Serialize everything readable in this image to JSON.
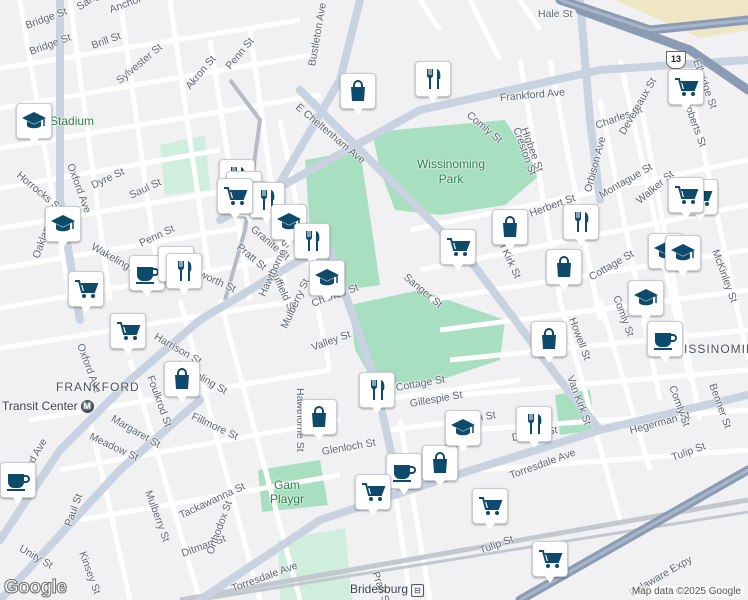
{
  "map": {
    "attribution": "Map data ©2025 Google",
    "logo": "Google",
    "route_shield": "13",
    "colors": {
      "background": "#f1f1f3",
      "street": "#ffffff",
      "major_road": "#c9d2e0",
      "highway": "#8a9bb3",
      "park": "#a8dfc0",
      "rail": "#b6bcc6",
      "poi_icon": "#0d4a6b"
    }
  },
  "places": [
    {
      "name": "FRANKFORD"
    },
    {
      "name": "ISSINOMIN"
    }
  ],
  "parks": [
    {
      "name": "Wissinoming Park"
    },
    {
      "name": "Gam Playgr"
    }
  ],
  "transit": {
    "frankford_center": "Transit Center",
    "frankford_center_icon": "M",
    "stadium": "ford Stadium",
    "bridesburg": "Bridesburg",
    "bridesburg_icon": "⊟"
  },
  "streets": [
    {
      "name": "Sanger St"
    },
    {
      "name": "Anchor St"
    },
    {
      "name": "Bridge St"
    },
    {
      "name": "Brill St"
    },
    {
      "name": "Sylvester St"
    },
    {
      "name": "Akron St"
    },
    {
      "name": "Penn St"
    },
    {
      "name": "Bustleton Ave"
    },
    {
      "name": "Frankford Ave"
    },
    {
      "name": "E Cheltenham Ave"
    },
    {
      "name": "Horrocks St"
    },
    {
      "name": "Oxford Ave"
    },
    {
      "name": "Dyre St"
    },
    {
      "name": "Saul St"
    },
    {
      "name": "Wakeling St"
    },
    {
      "name": "Penn St"
    },
    {
      "name": "Oakland St"
    },
    {
      "name": "Haworth St"
    },
    {
      "name": "Granite St"
    },
    {
      "name": "Pratt St"
    },
    {
      "name": "Duffield St"
    },
    {
      "name": "Hawthorne St"
    },
    {
      "name": "Mulberry St"
    },
    {
      "name": "Charles St"
    },
    {
      "name": "Valley St"
    },
    {
      "name": "Harrison St"
    },
    {
      "name": "Foulkrod St"
    },
    {
      "name": "Margaret St"
    },
    {
      "name": "Fillmore St"
    },
    {
      "name": "Meadow St"
    },
    {
      "name": "Glenloch St"
    },
    {
      "name": "Mulberry St"
    },
    {
      "name": "Tackawanna St"
    },
    {
      "name": "Ditman St"
    },
    {
      "name": "Orthodox St"
    },
    {
      "name": "Torresdale Ave"
    },
    {
      "name": "Pratt St"
    },
    {
      "name": "Paul St"
    },
    {
      "name": "Kinsey St"
    },
    {
      "name": "Unity St"
    },
    {
      "name": "Frankford Ave"
    },
    {
      "name": "Sanger St"
    },
    {
      "name": "Van Kirk St"
    },
    {
      "name": "Cottage St"
    },
    {
      "name": "Gillespie St"
    },
    {
      "name": "Jackson St"
    },
    {
      "name": "Ditman St"
    },
    {
      "name": "Torresdale Ave"
    },
    {
      "name": "Tulip St"
    },
    {
      "name": "Comly St"
    },
    {
      "name": "Higbee St"
    },
    {
      "name": "Creston St"
    },
    {
      "name": "Charles St"
    },
    {
      "name": "Devereaux St"
    },
    {
      "name": "Walker St"
    },
    {
      "name": "Cottage St"
    },
    {
      "name": "Comly St"
    },
    {
      "name": "Howell St"
    },
    {
      "name": "Van Kirk St"
    },
    {
      "name": "Hegerman St"
    },
    {
      "name": "Comly St"
    },
    {
      "name": "Tulip St"
    },
    {
      "name": "Benner St"
    },
    {
      "name": "McKinley St"
    },
    {
      "name": "Delaware Expy"
    },
    {
      "name": "Hale St"
    },
    {
      "name": "Elbridge St"
    },
    {
      "name": "Roberts St"
    },
    {
      "name": "Montague St"
    },
    {
      "name": "Herbert St"
    },
    {
      "name": "Orbison Ave"
    },
    {
      "name": "Hawthorne St"
    },
    {
      "name": "Wakeling St"
    },
    {
      "name": "Oxford Ave"
    },
    {
      "name": "Bridge St"
    }
  ],
  "pois": [
    {
      "type": "shopping"
    },
    {
      "type": "restaurant"
    },
    {
      "type": "school"
    },
    {
      "type": "cart"
    },
    {
      "type": "restaurant"
    },
    {
      "type": "restaurant"
    },
    {
      "type": "restaurant"
    },
    {
      "type": "restaurant"
    },
    {
      "type": "school"
    },
    {
      "type": "restaurant"
    },
    {
      "type": "school"
    },
    {
      "type": "cart"
    },
    {
      "type": "cafe"
    },
    {
      "type": "restaurant"
    },
    {
      "type": "restaurant"
    },
    {
      "type": "cart"
    },
    {
      "type": "shopping"
    },
    {
      "type": "shopping"
    },
    {
      "type": "restaurant"
    },
    {
      "type": "cart"
    },
    {
      "type": "shopping"
    },
    {
      "type": "restaurant"
    },
    {
      "type": "shopping"
    },
    {
      "type": "cart"
    },
    {
      "type": "cart"
    },
    {
      "type": "school"
    },
    {
      "type": "school"
    },
    {
      "type": "school"
    },
    {
      "type": "cafe"
    },
    {
      "type": "shopping"
    },
    {
      "type": "school"
    },
    {
      "type": "restaurant"
    },
    {
      "type": "cafe"
    },
    {
      "type": "shopping"
    },
    {
      "type": "school"
    },
    {
      "type": "cart"
    },
    {
      "type": "cart"
    },
    {
      "type": "cart"
    },
    {
      "type": "cafe"
    },
    {
      "type": "cart"
    }
  ]
}
